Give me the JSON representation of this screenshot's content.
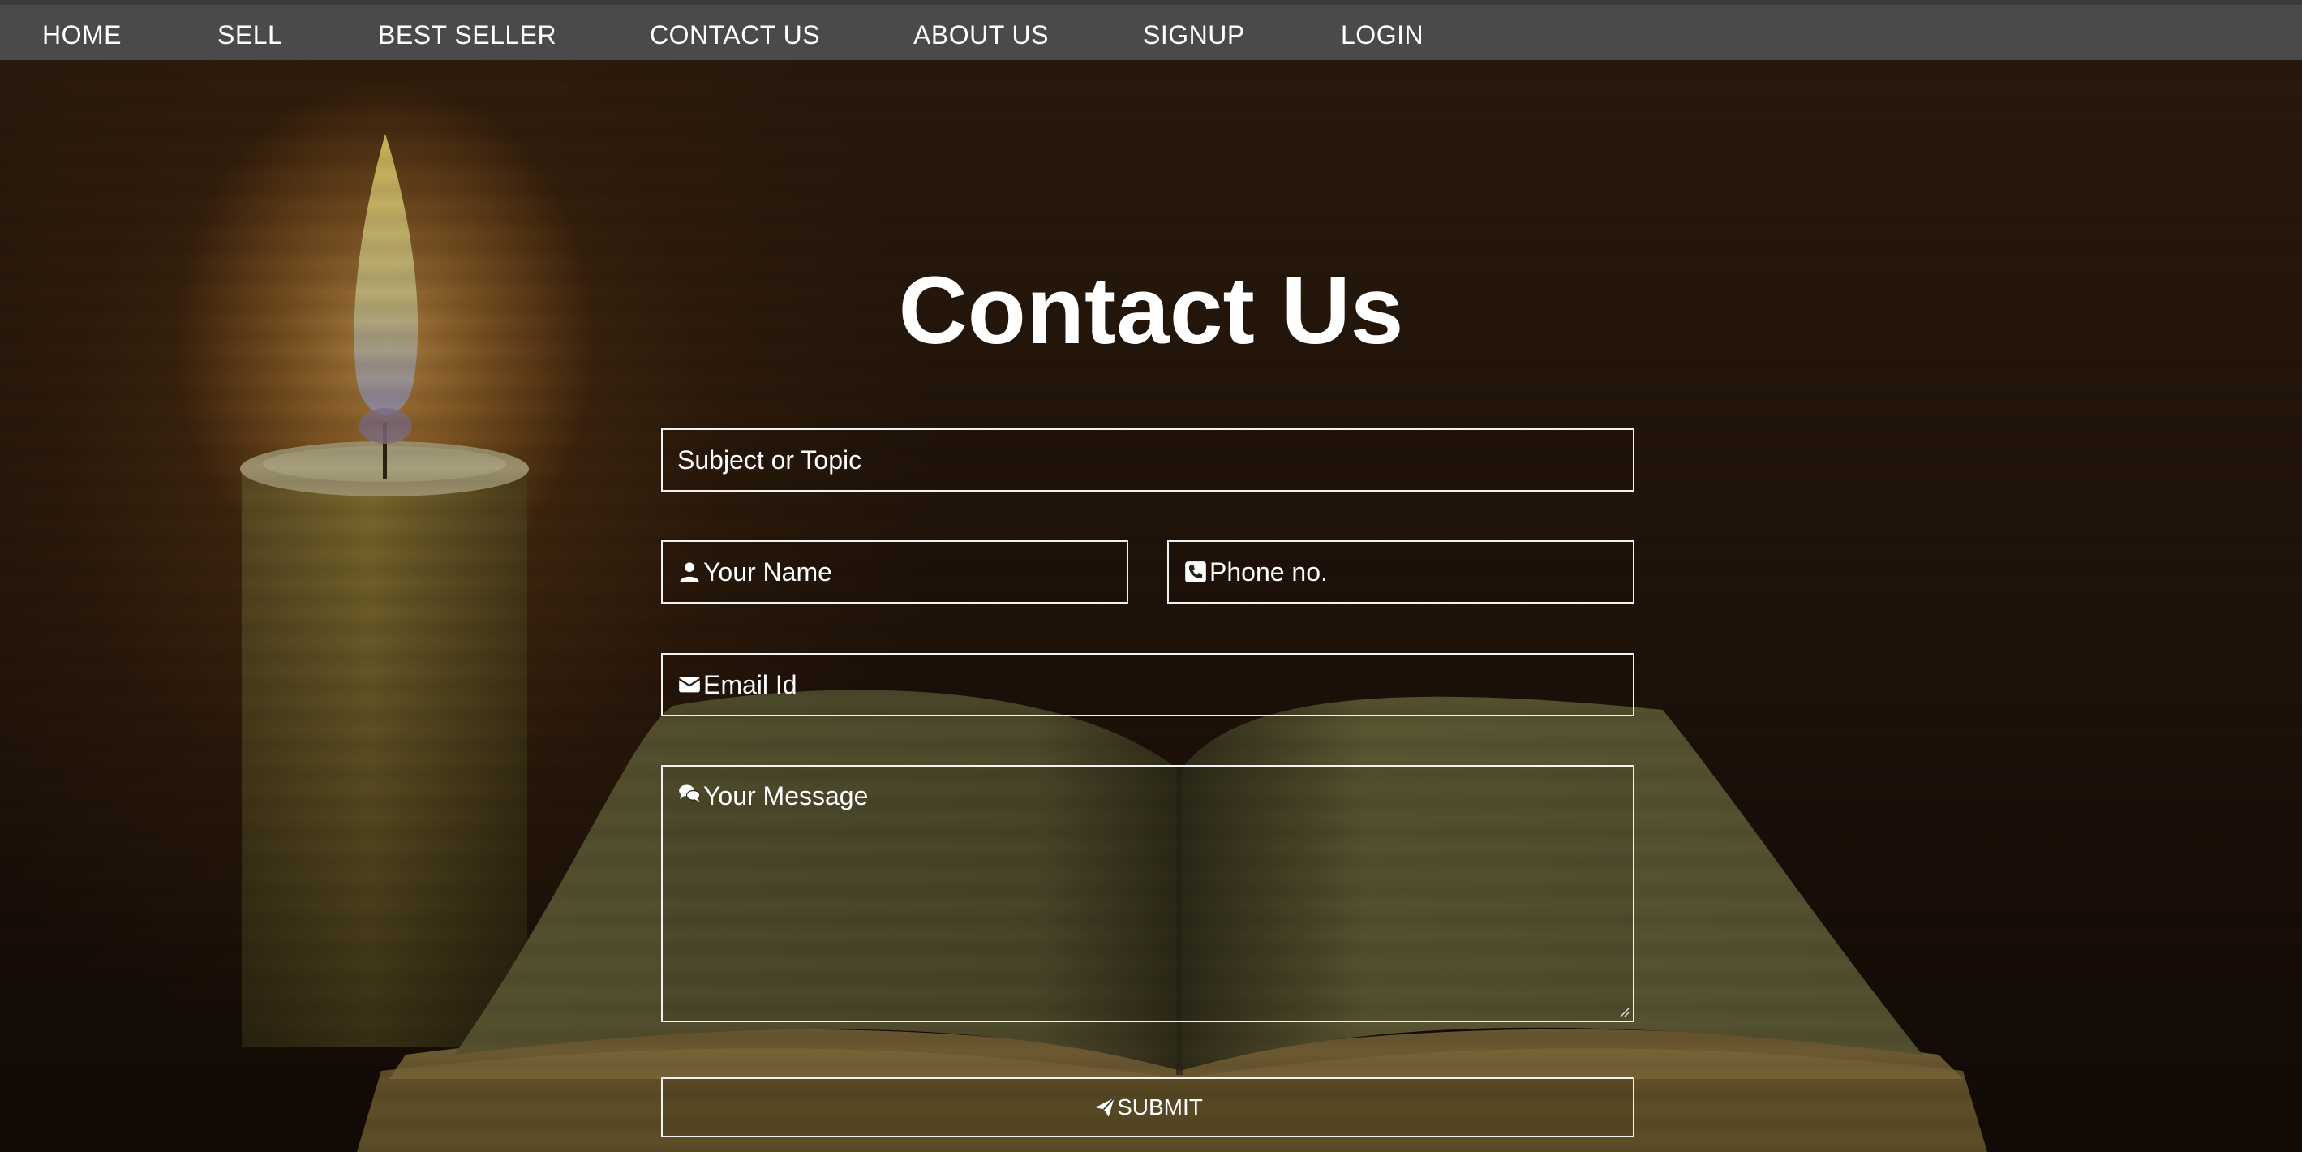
{
  "nav": {
    "items": [
      {
        "label": "HOME"
      },
      {
        "label": "SELL"
      },
      {
        "label": "BEST SELLER"
      },
      {
        "label": "CONTACT US"
      },
      {
        "label": "ABOUT US"
      },
      {
        "label": "SIGNUP"
      },
      {
        "label": "LOGIN"
      }
    ]
  },
  "page": {
    "title": "Contact Us"
  },
  "form": {
    "subject": {
      "placeholder": "Subject or Topic",
      "value": ""
    },
    "name": {
      "placeholder": "Your Name",
      "value": "",
      "icon": "user-icon"
    },
    "phone": {
      "placeholder": "Phone no.",
      "value": "",
      "icon": "phone-icon"
    },
    "email": {
      "placeholder": "Email Id",
      "value": "",
      "icon": "envelope-icon"
    },
    "message": {
      "placeholder": "Your Message",
      "value": "",
      "icon": "chat-bubbles-icon"
    },
    "submit": {
      "label": "SUBMIT",
      "icon": "paper-plane-icon"
    }
  },
  "colors": {
    "nav_bg": "#4a4a4a",
    "text": "#ffffff",
    "field_border": "#f2f2f2"
  }
}
